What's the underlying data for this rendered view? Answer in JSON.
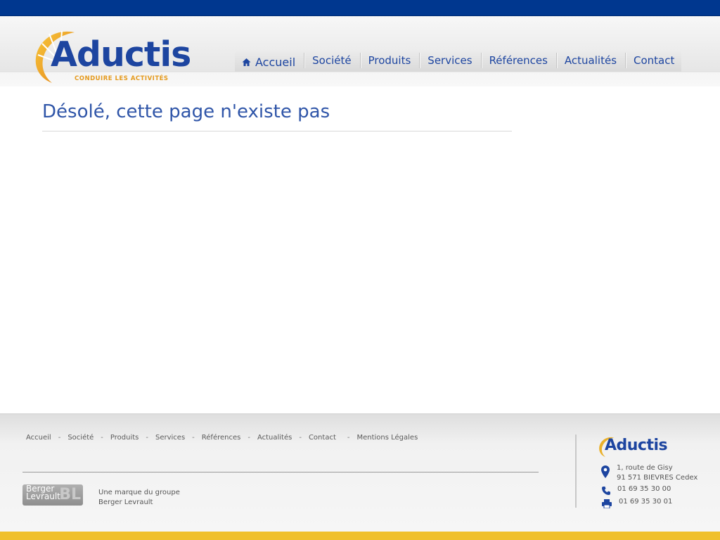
{
  "brand": {
    "name": "Aductis",
    "tagline": "CONDUIRE LES ACTIVITÉS"
  },
  "nav": {
    "items": [
      {
        "label": "Accueil",
        "icon": "home-icon"
      },
      {
        "label": "Société"
      },
      {
        "label": "Produits"
      },
      {
        "label": "Services"
      },
      {
        "label": "Références"
      },
      {
        "label": "Actualités"
      },
      {
        "label": "Contact"
      }
    ]
  },
  "main": {
    "title": "Désolé, cette page n'existe pas"
  },
  "footer": {
    "links": [
      "Accueil",
      "Société",
      "Produits",
      "Services",
      "Références",
      "Actualités",
      "Contact",
      "Mentions Légales"
    ],
    "group_logo_text": {
      "line1": "Berger",
      "line2": "Levrault",
      "mark": "BL"
    },
    "group_line1": "Une marque du groupe",
    "group_line2": "Berger Levrault",
    "contact": {
      "address_line1": "1, route de Gisy",
      "address_line2": "91 571 BIEVRES Cedex",
      "phone": "01 69 35 30 00",
      "fax": "01 69 35 30 01"
    }
  },
  "colors": {
    "top_bar": "#00378f",
    "brand_blue": "#1d45a0",
    "brand_orange": "#e59a1d",
    "bottom_bar": "#f0c02c"
  }
}
